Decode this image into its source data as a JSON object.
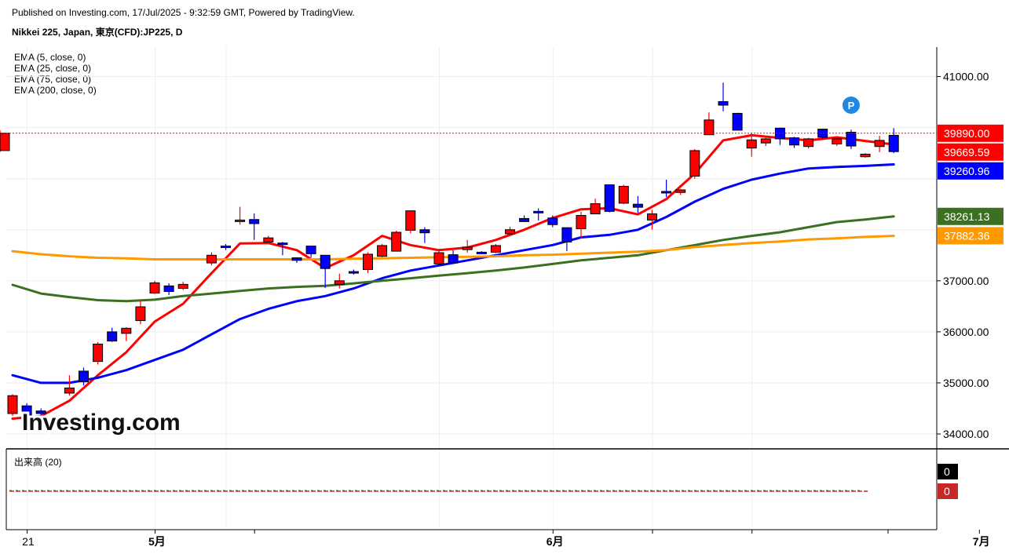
{
  "header": {
    "published": "Published on Investing.com, 17/Jul/2025 - 9:32:59 GMT, Powered by TradingView.",
    "symbol": "Nikkei 225, Japan, 東京(CFD):JP225, D"
  },
  "legend": {
    "ema5": "EMA (5, close, 0)",
    "ema25": "EMA (25, close, 0)",
    "ema75": "EMA (75, close, 0)",
    "ema200": "EMA (200, close, 0)"
  },
  "volume_label": "出来高 (20)",
  "logo": "Investing.com",
  "chart_data": {
    "type": "candlestick",
    "y_range": [
      33700,
      41700
    ],
    "y_ticks": [
      34000,
      35000,
      36000,
      37000,
      41000
    ],
    "y_tick_labels": [
      "34000.00",
      "35000.00",
      "36000.00",
      "37000.00",
      "41000.00"
    ],
    "x_labels": [
      "21",
      "5月",
      "6月",
      "7月"
    ],
    "x_label_index": [
      1,
      10,
      38,
      68
    ],
    "up_color": "#0000ff",
    "down_color": "#ff0000",
    "grid": true,
    "last_price": 39890,
    "candles": [
      {
        "o": 34750,
        "h": 34780,
        "l": 34350,
        "c": 34400
      },
      {
        "o": 34350,
        "h": 34600,
        "l": 34200,
        "c": 34550
      },
      {
        "o": 34400,
        "h": 34500,
        "l": 34300,
        "c": 34450
      },
      {
        "o": 34900,
        "h": 35150,
        "l": 34750,
        "c": 34800
      },
      {
        "o": 35020,
        "h": 35300,
        "l": 34950,
        "c": 35230
      },
      {
        "o": 35760,
        "h": 35800,
        "l": 35360,
        "c": 35420
      },
      {
        "o": 35820,
        "h": 36080,
        "l": 35800,
        "c": 36000
      },
      {
        "o": 36070,
        "h": 36090,
        "l": 35820,
        "c": 35970
      },
      {
        "o": 36490,
        "h": 36620,
        "l": 36150,
        "c": 36220
      },
      {
        "o": 36960,
        "h": 37000,
        "l": 36740,
        "c": 36760
      },
      {
        "o": 36790,
        "h": 36950,
        "l": 36720,
        "c": 36900
      },
      {
        "o": 36930,
        "h": 36980,
        "l": 36820,
        "c": 36850
      },
      {
        "o": 37500,
        "h": 37560,
        "l": 37300,
        "c": 37350
      },
      {
        "o": 37650,
        "h": 37720,
        "l": 37600,
        "c": 37680
      },
      {
        "o": 38190,
        "h": 38450,
        "l": 38100,
        "c": 38170
      },
      {
        "o": 38120,
        "h": 38320,
        "l": 37800,
        "c": 38200
      },
      {
        "o": 37840,
        "h": 37880,
        "l": 37730,
        "c": 37760
      },
      {
        "o": 37730,
        "h": 37760,
        "l": 37500,
        "c": 37740
      },
      {
        "o": 37400,
        "h": 37460,
        "l": 37350,
        "c": 37450
      },
      {
        "o": 37530,
        "h": 37600,
        "l": 37460,
        "c": 37680
      },
      {
        "o": 37240,
        "h": 37400,
        "l": 36860,
        "c": 37500
      },
      {
        "o": 37000,
        "h": 37140,
        "l": 36850,
        "c": 36930
      },
      {
        "o": 37160,
        "h": 37220,
        "l": 37120,
        "c": 37180
      },
      {
        "o": 37520,
        "h": 37560,
        "l": 37150,
        "c": 37220
      },
      {
        "o": 37690,
        "h": 37720,
        "l": 37460,
        "c": 37480
      },
      {
        "o": 37950,
        "h": 37980,
        "l": 37600,
        "c": 37580
      },
      {
        "o": 38370,
        "h": 38380,
        "l": 37930,
        "c": 37990
      },
      {
        "o": 37940,
        "h": 38050,
        "l": 37740,
        "c": 38000
      },
      {
        "o": 37550,
        "h": 37600,
        "l": 37340,
        "c": 37330
      },
      {
        "o": 37350,
        "h": 37600,
        "l": 37340,
        "c": 37510
      },
      {
        "o": 37660,
        "h": 37800,
        "l": 37550,
        "c": 37610
      },
      {
        "o": 37530,
        "h": 37580,
        "l": 37520,
        "c": 37560
      },
      {
        "o": 37690,
        "h": 37720,
        "l": 37540,
        "c": 37560
      },
      {
        "o": 38000,
        "h": 38060,
        "l": 37880,
        "c": 37920
      },
      {
        "o": 38160,
        "h": 38280,
        "l": 38150,
        "c": 38220
      },
      {
        "o": 38350,
        "h": 38420,
        "l": 38180,
        "c": 38360
      },
      {
        "o": 38100,
        "h": 38280,
        "l": 38050,
        "c": 38230
      },
      {
        "o": 37760,
        "h": 38000,
        "l": 37580,
        "c": 38040
      },
      {
        "o": 38280,
        "h": 38350,
        "l": 37830,
        "c": 38020
      },
      {
        "o": 38510,
        "h": 38610,
        "l": 38320,
        "c": 38310
      },
      {
        "o": 38360,
        "h": 38880,
        "l": 38340,
        "c": 38880
      },
      {
        "o": 38850,
        "h": 38880,
        "l": 38500,
        "c": 38520
      },
      {
        "o": 38440,
        "h": 38660,
        "l": 38330,
        "c": 38500
      },
      {
        "o": 38310,
        "h": 38390,
        "l": 38000,
        "c": 38190
      },
      {
        "o": 38720,
        "h": 38980,
        "l": 38640,
        "c": 38750
      },
      {
        "o": 38780,
        "h": 38800,
        "l": 38680,
        "c": 38730
      },
      {
        "o": 39550,
        "h": 39580,
        "l": 39000,
        "c": 39050
      },
      {
        "o": 40150,
        "h": 40300,
        "l": 39880,
        "c": 39860
      },
      {
        "o": 40440,
        "h": 40880,
        "l": 40320,
        "c": 40510
      },
      {
        "o": 39950,
        "h": 40290,
        "l": 39960,
        "c": 40280
      },
      {
        "o": 39760,
        "h": 39900,
        "l": 39430,
        "c": 39600
      },
      {
        "o": 39780,
        "h": 39800,
        "l": 39640,
        "c": 39700
      },
      {
        "o": 39780,
        "h": 40000,
        "l": 39660,
        "c": 39990
      },
      {
        "o": 39660,
        "h": 39820,
        "l": 39600,
        "c": 39800
      },
      {
        "o": 39780,
        "h": 39800,
        "l": 39590,
        "c": 39630
      },
      {
        "o": 39810,
        "h": 39980,
        "l": 39770,
        "c": 39970
      },
      {
        "o": 39780,
        "h": 39820,
        "l": 39640,
        "c": 39680
      },
      {
        "o": 39640,
        "h": 39960,
        "l": 39580,
        "c": 39910
      },
      {
        "o": 39480,
        "h": 39500,
        "l": 39410,
        "c": 39430
      },
      {
        "o": 39750,
        "h": 39840,
        "l": 39520,
        "c": 39630
      },
      {
        "o": 39530,
        "h": 39990,
        "l": 39500,
        "c": 39850
      },
      {
        "o": 39890,
        "h": 39950,
        "l": 39520,
        "c": 39550
      }
    ],
    "candle_index": [
      0,
      1,
      2,
      4,
      5,
      6,
      7,
      8,
      9,
      10,
      11,
      12,
      14,
      15,
      16,
      17,
      18,
      19,
      20,
      21,
      22,
      23,
      24,
      25,
      26,
      27,
      28,
      29,
      30,
      31,
      32,
      33,
      34,
      35,
      36,
      37,
      38,
      39,
      40,
      41,
      42,
      43,
      44,
      45,
      46,
      47,
      48,
      49,
      50,
      51,
      52,
      53,
      54,
      55,
      56,
      57,
      58,
      59,
      60,
      61,
      62
    ],
    "ema": [
      {
        "name": "EMA (5, close, 0)",
        "color": "#ff0000",
        "points": [
          [
            0,
            34300
          ],
          [
            2,
            34350
          ],
          [
            4,
            34650
          ],
          [
            6,
            35150
          ],
          [
            8,
            35600
          ],
          [
            10,
            36200
          ],
          [
            12,
            36550
          ],
          [
            14,
            37150
          ],
          [
            16,
            37730
          ],
          [
            18,
            37740
          ],
          [
            20,
            37600
          ],
          [
            22,
            37250
          ],
          [
            24,
            37500
          ],
          [
            26,
            37880
          ],
          [
            28,
            37700
          ],
          [
            30,
            37600
          ],
          [
            32,
            37650
          ],
          [
            34,
            37800
          ],
          [
            36,
            38000
          ],
          [
            38,
            38230
          ],
          [
            40,
            38400
          ],
          [
            42,
            38420
          ],
          [
            44,
            38300
          ],
          [
            46,
            38600
          ],
          [
            48,
            39100
          ],
          [
            50,
            39750
          ],
          [
            52,
            39850
          ],
          [
            54,
            39800
          ],
          [
            56,
            39750
          ],
          [
            58,
            39810
          ],
          [
            60,
            39740
          ],
          [
            62,
            39670
          ]
        ]
      },
      {
        "name": "EMA (25, close, 0)",
        "color": "#0000ff",
        "points": [
          [
            0,
            35150
          ],
          [
            2,
            35000
          ],
          [
            4,
            35000
          ],
          [
            6,
            35100
          ],
          [
            8,
            35250
          ],
          [
            10,
            35450
          ],
          [
            12,
            35650
          ],
          [
            14,
            35950
          ],
          [
            16,
            36250
          ],
          [
            18,
            36450
          ],
          [
            20,
            36600
          ],
          [
            22,
            36700
          ],
          [
            24,
            36850
          ],
          [
            26,
            37050
          ],
          [
            28,
            37200
          ],
          [
            30,
            37300
          ],
          [
            32,
            37400
          ],
          [
            34,
            37500
          ],
          [
            36,
            37600
          ],
          [
            38,
            37700
          ],
          [
            40,
            37850
          ],
          [
            42,
            37900
          ],
          [
            44,
            38000
          ],
          [
            46,
            38250
          ],
          [
            48,
            38550
          ],
          [
            50,
            38800
          ],
          [
            52,
            38980
          ],
          [
            54,
            39100
          ],
          [
            56,
            39200
          ],
          [
            58,
            39230
          ],
          [
            60,
            39250
          ],
          [
            62,
            39280
          ]
        ]
      },
      {
        "name": "EMA (75, close, 0)",
        "color": "#3a7020",
        "points": [
          [
            0,
            36920
          ],
          [
            2,
            36750
          ],
          [
            4,
            36680
          ],
          [
            6,
            36620
          ],
          [
            8,
            36600
          ],
          [
            10,
            36630
          ],
          [
            12,
            36700
          ],
          [
            14,
            36750
          ],
          [
            16,
            36800
          ],
          [
            18,
            36850
          ],
          [
            20,
            36880
          ],
          [
            22,
            36900
          ],
          [
            24,
            36950
          ],
          [
            26,
            37000
          ],
          [
            28,
            37050
          ],
          [
            30,
            37100
          ],
          [
            32,
            37150
          ],
          [
            34,
            37200
          ],
          [
            36,
            37260
          ],
          [
            38,
            37330
          ],
          [
            40,
            37400
          ],
          [
            42,
            37450
          ],
          [
            44,
            37500
          ],
          [
            46,
            37600
          ],
          [
            48,
            37700
          ],
          [
            50,
            37800
          ],
          [
            52,
            37880
          ],
          [
            54,
            37950
          ],
          [
            56,
            38050
          ],
          [
            58,
            38150
          ],
          [
            60,
            38200
          ],
          [
            62,
            38260
          ]
        ]
      },
      {
        "name": "EMA (200, close, 0)",
        "color": "#ff9900",
        "points": [
          [
            0,
            37580
          ],
          [
            2,
            37520
          ],
          [
            4,
            37480
          ],
          [
            6,
            37450
          ],
          [
            8,
            37440
          ],
          [
            10,
            37420
          ],
          [
            12,
            37420
          ],
          [
            14,
            37420
          ],
          [
            16,
            37420
          ],
          [
            18,
            37420
          ],
          [
            20,
            37420
          ],
          [
            22,
            37420
          ],
          [
            24,
            37430
          ],
          [
            26,
            37440
          ],
          [
            28,
            37450
          ],
          [
            30,
            37460
          ],
          [
            32,
            37470
          ],
          [
            34,
            37480
          ],
          [
            36,
            37500
          ],
          [
            38,
            37510
          ],
          [
            40,
            37530
          ],
          [
            42,
            37550
          ],
          [
            44,
            37570
          ],
          [
            46,
            37600
          ],
          [
            48,
            37660
          ],
          [
            50,
            37700
          ],
          [
            52,
            37740
          ],
          [
            54,
            37770
          ],
          [
            56,
            37810
          ],
          [
            58,
            37830
          ],
          [
            60,
            37860
          ],
          [
            62,
            37880
          ]
        ]
      }
    ],
    "price_tags": [
      {
        "label": "39890.00",
        "value": 39890,
        "bg": "#ff0000"
      },
      {
        "label": "39669.59",
        "value": 39669.59,
        "bg": "#ff0000"
      },
      {
        "label": "39260.96",
        "value": 39260.96,
        "bg": "#0000ff"
      },
      {
        "label": "38261.13",
        "value": 38261.13,
        "bg": "#3a7020"
      },
      {
        "label": "37882.36",
        "value": 37882.36,
        "bg": "#ff9900"
      }
    ],
    "volume_tags": [
      {
        "label": "0",
        "bg": "#000000"
      },
      {
        "label": "0",
        "bg": "#c62828"
      }
    ],
    "marker": "P"
  }
}
